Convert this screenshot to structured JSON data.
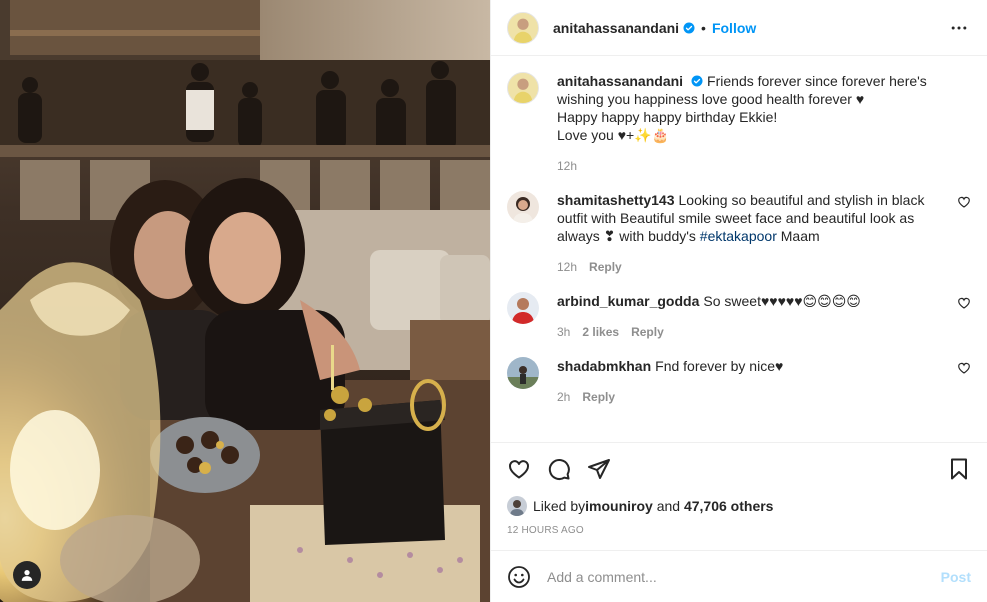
{
  "post_author": {
    "username": "anitahassanandani",
    "verified": true,
    "follow_label": "Follow",
    "separator": "•"
  },
  "caption": {
    "username": "anitahassanandani",
    "line1": "Friends forever since forever here's wishing you happiness love good health forever ♥",
    "line2": "Happy happy happy birthday Ekkie!",
    "line3": "Love you ♥+✨🎂",
    "time": "12h"
  },
  "comments": [
    {
      "username": "shamitashetty143",
      "text": "Looking so beautiful and stylish in black outfit with Beautiful smile sweet face and beautiful look as always ❣ with buddy's ",
      "hashtag": "#ektakapoor",
      "text_after": " Maam",
      "time": "12h",
      "likes": "",
      "reply": "Reply"
    },
    {
      "username": "arbind_kumar_godda",
      "text": "So sweet♥♥♥♥♥😊😊😊😊",
      "time": "3h",
      "likes": "2 likes",
      "reply": "Reply"
    },
    {
      "username": "shadabmkhan",
      "text": "Fnd forever by nice♥",
      "time": "2h",
      "likes": "",
      "reply": "Reply"
    }
  ],
  "likes_summary": {
    "prefix": "Liked by ",
    "user": "imouniroy",
    "middle": " and ",
    "count": "47,706 others"
  },
  "timestamp": "12 HOURS AGO",
  "comment_box": {
    "placeholder": "Add a comment...",
    "post_label": "Post"
  },
  "colors": {
    "accent": "#0095f6",
    "post_disabled": "#b2dffc",
    "hashtag": "#00376b",
    "muted": "#8e8e8e"
  },
  "icons": {
    "header_more": "more-horizontal-icon",
    "like": "heart-icon",
    "comment": "comment-icon",
    "share": "share-icon",
    "save": "bookmark-icon",
    "emoji": "emoji-icon",
    "tag": "user-tag-icon"
  }
}
